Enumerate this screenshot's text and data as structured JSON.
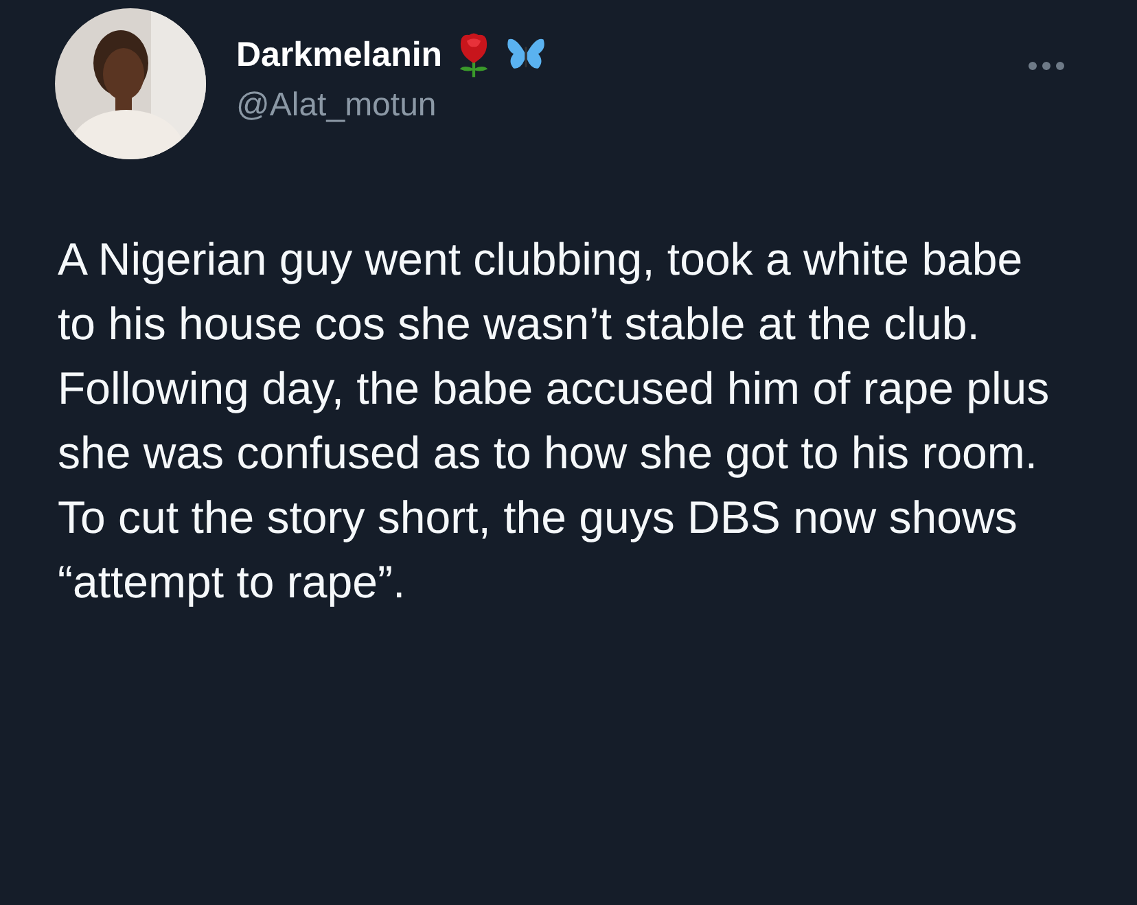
{
  "tweet": {
    "display_name": "Darkmelanin",
    "handle": "@Alat_motun",
    "text": "A Nigerian guy went clubbing, took a white babe to his house cos she wasn’t stable at the club. Following day, the babe accused him of rape plus she was confused as to how she got to his room. To cut the story short, the guys DBS now shows “attempt to rape”."
  }
}
